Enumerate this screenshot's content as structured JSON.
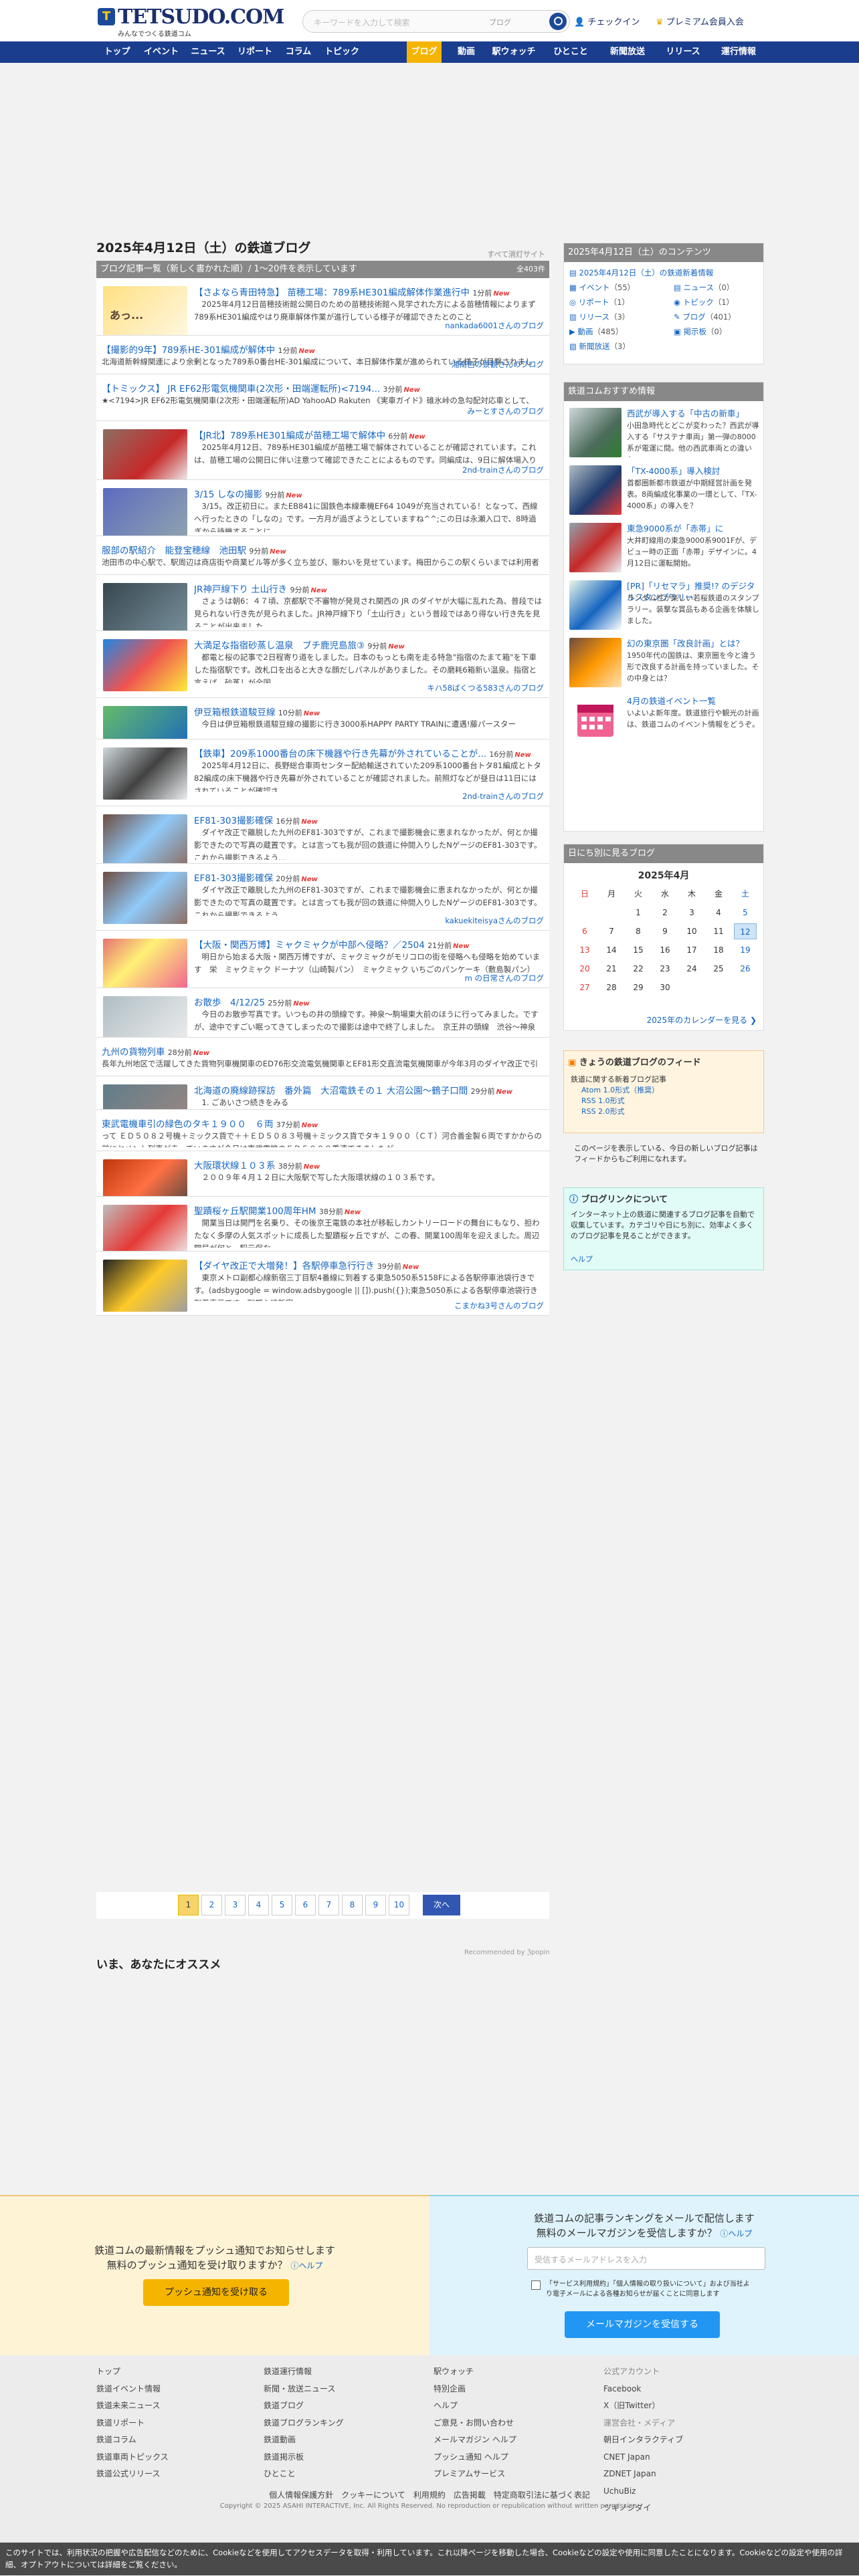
{
  "header": {
    "logo_text": "TETSUDO.COM",
    "logo_tagline": "みんなでつくる鉄道コム",
    "search_placeholder": "キーワードを入力して検索",
    "search_scope": "ブログ",
    "checkin": "チェックイン",
    "premium": "プレミアム会員入会"
  },
  "nav": [
    "トップ",
    "イベント",
    "ニュース",
    "リポート",
    "コラム",
    "トピック",
    "ブログ",
    "動画",
    "駅ウォッチ",
    "ひとこと",
    "新聞放送",
    "リリース",
    "運行情報"
  ],
  "page": {
    "title": "2025年4月12日（土）の鉄道ブログ",
    "rss_toggle": "すべて消灯サイト",
    "list_head": "ブログ記事一覧（新しく書かれた順）/ 1〜20件を表示しています",
    "total": "全403件"
  },
  "entries": [
    {
      "title": "【さよなら青田特急】 苗穂工場：789系HE301編成解体作業進行中",
      "ago": "1分前",
      "new": "New",
      "body": "2025年4月12日苗穂技術館公開日のための苗穂技術館へ見学された方による苗穂情報によりまず789系HE301編成やはり廃車解体作業が進行している様子が確認できたとのこと",
      "author": "nankada6001さんのブログ",
      "thumb_text": "あっ..."
    },
    {
      "title": "【撮影的9年】789系HE-301編成が解体中",
      "ago": "1分前",
      "new": "New",
      "body": "北海道新幹線関連により余剰となった789系0番台HE-301編成について、本日解体作業が進められている様子が目撃されました。",
      "author": "湘南色の景観さんのブログ"
    },
    {
      "title": "【トミックス】 JR EF62形電気機関車(2次形・田端運転所)<7194...",
      "ago": "3分前",
      "new": "New",
      "body": "★<7194>JR EF62形電気機関車(2次形・田端運転所)AD YahooAD Rakuten 《実車ガイド》碓氷峠の急勾配対応車として、1962年に登場した国鉄EF62形。信越本線・高崎線等で活躍し、碓氷峠区間では補機EF63との協調運...",
      "author": "みーとすさんのブログ"
    },
    {
      "title": "【JR北】789系HE301編成が苗穂工場で解体中",
      "ago": "6分前",
      "new": "New",
      "body": "2025年4月12日、789系HE301編成が苗穂工場で解体されていることが確認されています。これは、苗穂工場の公開日に伴い注意つて確認できたことによるものです。同編成は、9日に解体場入りが確認され...",
      "author": "2nd-trainさんのブログ"
    },
    {
      "title": "3/15 しなの撮影",
      "ago": "9分前",
      "new": "New",
      "body": "3/15。改正初日に。またEB841に国鉄色本線牽機EF64 1049が充当されている！となって、西線へ行ったときの「しなの」です。一方月が過ぎようとしていますね^^;この日は永瀬入口で、8時過ぎから待機することに...",
      "author": ""
    },
    {
      "title": "服部の駅紹介　能登宝穂線　池田駅",
      "ago": "9分前",
      "new": "New",
      "body": "池田市の中心駅で、駅周辺は商店街や商業ビル等が多く立ち並び、賑わいを見せています。梅田からこの駅くらいまでは利用者数も多いですが、この先から少し宝塚駅までの区間は利用者の極端も近寄して利用者が...",
      "author": ""
    },
    {
      "title": "JR神戸線下り 土山行き",
      "ago": "9分前",
      "new": "New",
      "body": "さょうは朝6：４７頃、京都駅で不審物が発見され関西の JR のダイヤが大幅に乱れた為、普段では見られない行き先が見られました。JR神戸線下り「土山行き」という普段ではあり得ない行き先を見ることが出来ました。",
      "author": ""
    },
    {
      "title": "大満足な指宿砂蒸し温泉　ブチ鹿児島旅③",
      "ago": "9分前",
      "new": "New",
      "body": "都電と桜の記事で2日程寄り道をしました。日本のもっとも南を走る特急\"指宿のたまて箱\"を下車した指宿駅です。改札口を出ると大きな顔だしパネルがありました。その磨耗6箱新い温泉。指宿と言えば、砂蒸しが全国...",
      "author": "キハ58ばくつる583さんのブログ"
    },
    {
      "title": "伊豆箱根鉄道駿豆線",
      "ago": "10分前",
      "new": "New",
      "body": "今日は伊豆箱根鉄道駿豆線の撮影に行き3000系HAPPY PARTY TRAINに遭遇!藤パースター",
      "author": ""
    },
    {
      "title": "【鉄車】209系1000番台の床下機器や行き先幕が外されていることが...",
      "ago": "16分前",
      "new": "New",
      "body": "2025年4月12日に、長野総合車両センター配給輸送されていた209系1000番台トタ81編成とトタ82編成の床下機器や行き先幕が外されていることが確認されました。前照灯などが昼日は11日にはされていることが確認さ...",
      "author": "2nd-trainさんのブログ"
    },
    {
      "title": "EF81-303撮影確保",
      "ago": "16分前",
      "new": "New",
      "body": "ダイヤ改正で離脱した九州のEF81-303ですが、これまで撮影機会に恵まれなかったが、何とか撮影できたので写真の蔵置です。とは言っても我が回の鉄道に仲間入りしたNゲージのEF81-303です。これから撮影できるよう...",
      "author": ""
    },
    {
      "title": "EF81-303撮影確保",
      "ago": "20分前",
      "new": "New",
      "body": "ダイヤ改正で離脱した九州のEF81-303ですが、これまで撮影機会に恵まれなかったが、何とか撮影できたので写真の蔵置です。とは言っても我が回の鉄道に仲間入りしたNゲージのEF81-303です。これから撮影できるよう...",
      "author": "kakuekiteisyaさんのブログ"
    },
    {
      "title": "【大阪・関西万博】ミャクミャクが中部へ侵略？／2504",
      "ago": "21分前",
      "new": "New",
      "body": "明日から始まる大阪・関西万博ですが、ミャクミャクがモリコロの街を侵略へも侵略を始めています　栄　ミャクミャク ドーナツ（山崎製パン）　ミャクミャク いちごのパンケーキ（敷島製パン）　ーーーーーー...",
      "author": "m の日常さんのブログ"
    },
    {
      "title": "お散歩　4/12/25",
      "ago": "25分前",
      "new": "New",
      "body": "今日のお散歩写真です。いつもの井の頭線です。神泉〜駒場東大前のほうに行ってみました。ですが、途中ですごい眠ってきてしまったので撮影は途中で終了しました。　京王井の頭線　渋谷〜神泉　京王井の頭線...",
      "author": ""
    },
    {
      "title": "九州の貨物列車",
      "ago": "28分前",
      "new": "New",
      "body": "長年九州地区で活躍してきた貨物列車機関車のED76形交流電気機関車とEF81形交直流電気機関車が今年3月のダイヤ改正で引退し、EH500形交直流電気機関車とEF510形交直流電気機関車に引き継がれました。長年九州地区で...",
      "author": ""
    },
    {
      "title": "北海道の廃線跡探訪　番外篇　大沼電鉄その１ 大沼公園〜鶴子口間",
      "ago": "29分前",
      "new": "New",
      "body": "1. ごあいさつ続きをみる",
      "author": ""
    },
    {
      "title": "東武電機車引の緑色のタキ１９００　６両",
      "ago": "37分前",
      "new": "New",
      "body": "って ＥＤ５０８２号機＋ミックス貨で＋＋ＥＤ５０８３号機＋ミックス貨でタキ１９００（ＣＴ）河合善金製６両ですかからの前にセメント列車が走っていますが今日は東武電機のＥＤ５０８０重連できましたが...",
      "author": ""
    },
    {
      "title": "大阪環状線１０３系",
      "ago": "38分前",
      "new": "New",
      "body": "２００９年４月１２日に大阪駅で写した大阪環状線の１０３系です。",
      "author": ""
    },
    {
      "title": "聖蹟桜ヶ丘駅開業100周年HM",
      "ago": "38分前",
      "new": "New",
      "body": "開業当日は開門を名乗り、その後京王電鉄の本社が移転しカントリーロードの舞台にもなり、担わたなく多摩の人気スポットに成長した聖蹟桜ヶ丘ですが、この春、開業100周年を迎えました。周辺開局が何と、駅元保な...",
      "author": ""
    },
    {
      "title": "【ダイヤ改正で大増発！】各駅停車急行行き",
      "ago": "39分前",
      "new": "New",
      "body": "東京メトロ副都心線新宿三丁目駅4番線に到着する東急5050系5158Fによる各駅停車池袋行きです。(adsbygoogle = window.adsbygoogle || []).push({});東急5050系による各駅停車池袋行き到着表示です。副都心線新宿...",
      "author": "こまかね3号さんのブログ"
    }
  ],
  "pager": {
    "pages": [
      "1",
      "2",
      "3",
      "4",
      "5",
      "6",
      "7",
      "8",
      "9",
      "10"
    ],
    "next": "次へ"
  },
  "reco": {
    "title": "いま、あなたにオススメ",
    "popin": "Recommended by ℨpopin"
  },
  "side_contents": {
    "title": "2025年4月12日（土）のコンテンツ",
    "items": [
      {
        "label": "2025年4月12日（土）の鉄道新着情報",
        "count": ""
      },
      {
        "label": "イベント",
        "count": "（55）"
      },
      {
        "label": "ニュース",
        "count": "（0）"
      },
      {
        "label": "リポート",
        "count": "（1）"
      },
      {
        "label": "トピック",
        "count": "（1）"
      },
      {
        "label": "リリース",
        "count": "（3）"
      },
      {
        "label": "ブログ",
        "count": "（401）"
      },
      {
        "label": "動画",
        "count": "（485）"
      },
      {
        "label": "掲示板",
        "count": "（0）"
      },
      {
        "label": "新聞放送",
        "count": "（3）"
      }
    ]
  },
  "side_news": {
    "title": "鉄道コムおすすめ情報",
    "items": [
      {
        "title": "西武が導入する「中古の新車」",
        "body": "小田急時代とどこが変わった？西武が導入する「サステナ車両」第一弾の8000系が電運に間。他の西武車両との違いも..."
      },
      {
        "title": "「TX-4000系」導入検討",
        "body": "首都圏新都市鉄道が中期経営計画を発表。8両編成化事業の一環として、「TX-4000系」の導入を？"
      },
      {
        "title": "東急9000系が「赤帯」に",
        "body": "大井町線用の東急9000系9001Fが、デビュー時の正面「赤帯」デザインに。4月12日に運転開始。"
      },
      {
        "title": "[PR]「リセマラ」推奨!? のデジタルスタンプラリー",
        "body": "ランダム性が楽しい若桜鉄道のスタンプラリー。装撃な賞品もある企画を体験しました。"
      },
      {
        "title": "幻の東京圏「改良計画」とは？",
        "body": "1950年代の国鉄は、東京圏を今と違う形で改良する計画を持っていました。その中身とは？"
      },
      {
        "title": "4月の鉄道イベント一覧",
        "body": "いよいよ新年度。鉄道旅行や観光の計画は、鉄道コムのイベント情報をどうぞ。"
      }
    ]
  },
  "calendar": {
    "title": "日にち別に見るブログ",
    "month": "2025年4月",
    "week": [
      "日",
      "月",
      "火",
      "水",
      "木",
      "金",
      "土"
    ],
    "weeks": [
      [
        "",
        "",
        "1",
        "2",
        "3",
        "4",
        "5"
      ],
      [
        "6",
        "7",
        "8",
        "9",
        "10",
        "11",
        "12"
      ],
      [
        "13",
        "14",
        "15",
        "16",
        "17",
        "18",
        "19"
      ],
      [
        "20",
        "21",
        "22",
        "23",
        "24",
        "25",
        "26"
      ],
      [
        "27",
        "28",
        "29",
        "30",
        "",
        "",
        ""
      ]
    ],
    "today": "12",
    "link": "2025年のカレンダーを見る"
  },
  "feed": {
    "title": "きょうの鉄道ブログのフィード",
    "desc": "鉄道に関する新着ブログ記事",
    "links": [
      "Atom 1.0形式（推奨）",
      "RSS 1.0形式",
      "RSS 2.0形式"
    ],
    "note": "このページを表示している、今日の新しいブログ記事はフィードからもご利用になれます。"
  },
  "about": {
    "title": "ブログリンクについて",
    "body": "インターネット上の鉄道に関連するブログ記事を自動で収集しています。カテゴリや日にち別に、効率よく多くのブログ記事を見ることができます。",
    "help": "ヘルプ"
  },
  "push": {
    "line1": "鉄道コムの最新情報をプッシュ通知でお知らせします",
    "line2": "無料のプッシュ通知を受け取りますか？",
    "help": "ヘルプ",
    "button": "プッシュ通知を受け取る"
  },
  "mail": {
    "line1": "鉄道コムの記事ランキングをメールで配信します",
    "line2": "無料のメールマガジンを受信しますか？",
    "help": "ヘルプ",
    "placeholder": "受信するメールアドレスを入力",
    "agree": "「サービス利用規約」「個人情報の取り扱いについて」および当社より電子メールによる各種お知らせが届くことに同意します",
    "button": "メールマガジンを受信する"
  },
  "footer": {
    "cols": [
      [
        "トップ",
        "鉄道イベント情報",
        "鉄道未来ニュース",
        "鉄道リポート",
        "鉄道コラム",
        "鉄道車両トピックス",
        "鉄道公式リリース"
      ],
      [
        "鉄道運行情報",
        "新聞・放送ニュース",
        "鉄道ブログ",
        "鉄道ブログランキング",
        "鉄道動画",
        "鉄道掲示板",
        "ひとこと"
      ],
      [
        "駅ウォッチ",
        "特別企画",
        "ヘルプ",
        "ご意見・お問い合わせ",
        "メールマガジン ヘルプ",
        "プッシュ通知 ヘルプ",
        "プレミアムサービス"
      ],
      [
        "公式アカウント",
        "Facebook",
        "X（旧Twitter）",
        "運営会社・メディア",
        "朝日インタラクティブ",
        "CNET Japan",
        "ZDNET Japan",
        "UchuBiz",
        "ツギノジダイ"
      ]
    ],
    "links": "個人情報保護方針　クッキーについて　利用規約　広告掲載　特定商取引法に基づく表記",
    "copyright": "Copyright © 2025 ASAHI INTERACTIVE, Inc. All Rights Reserved. No reproduction or republication without written permission."
  },
  "cookie": "このサイトでは、利用状況の把握や広告配信などのために、Cookieなどを使用してアクセスデータを取得・利用しています。これ以降ページを移動した場合、Cookieなどの設定や使用に同意したことになります。Cookieなどの設定や使用の詳細、オプトアウトについては詳細をご覧ください。"
}
